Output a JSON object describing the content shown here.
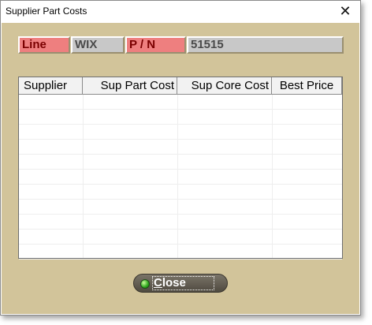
{
  "window": {
    "title": "Supplier Part Costs"
  },
  "fields": {
    "line_label": "Line",
    "line_value": "WIX",
    "pn_label": "P / N",
    "pn_value": "51515"
  },
  "grid": {
    "columns": [
      "Supplier",
      "Sup Part Cost",
      "Sup Core Cost",
      "Best Price"
    ],
    "rows": []
  },
  "buttons": {
    "close_mnemonic": "C",
    "close_rest": "lose"
  },
  "colors": {
    "client_bg": "#d2c49a",
    "label_bg": "#ee7f7f",
    "label_text": "#7a0000",
    "value_bg": "#c8c8c8"
  }
}
